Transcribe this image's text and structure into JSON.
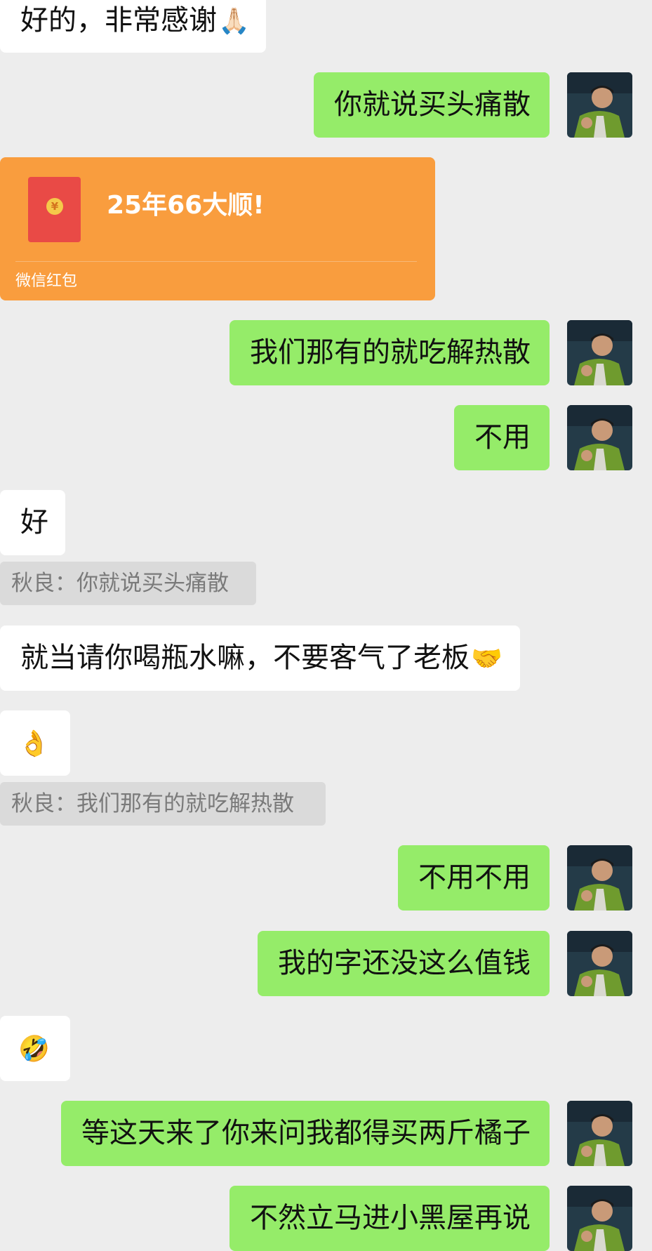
{
  "messages": {
    "m1": {
      "text": "好的，非常感谢",
      "emoji": "🙏🏻"
    },
    "m2": {
      "text": "你就说买头痛散"
    },
    "m4": {
      "text": "我们那有的就吃解热散"
    },
    "m5": {
      "text": "不用"
    },
    "m6": {
      "text": "好"
    },
    "m7": {
      "text": "就当请你喝瓶水嘛，不要客气了老板",
      "emoji": "🤝"
    },
    "m8": {
      "emoji": "👌"
    },
    "m9": {
      "text": "不用不用"
    },
    "m10": {
      "text": "我的字还没这么值钱"
    },
    "m11": {
      "emoji": "🤣"
    },
    "m12": {
      "text": "等这天来了你来问我都得买两斤橘子"
    },
    "m13": {
      "text": "不然立马进小黑屋再说"
    }
  },
  "quotes": {
    "q1": "秋良：你就说买头痛散",
    "q2": "秋良：我们那有的就吃解热散"
  },
  "red_packet": {
    "title": "25年66大顺!",
    "footer": "微信红包",
    "coin_symbol": "¥"
  },
  "colors": {
    "background": "#ededed",
    "bubble_incoming": "#ffffff",
    "bubble_outgoing": "#95ec69",
    "quote_background": "#dadada",
    "red_packet": "#f99d3e"
  }
}
